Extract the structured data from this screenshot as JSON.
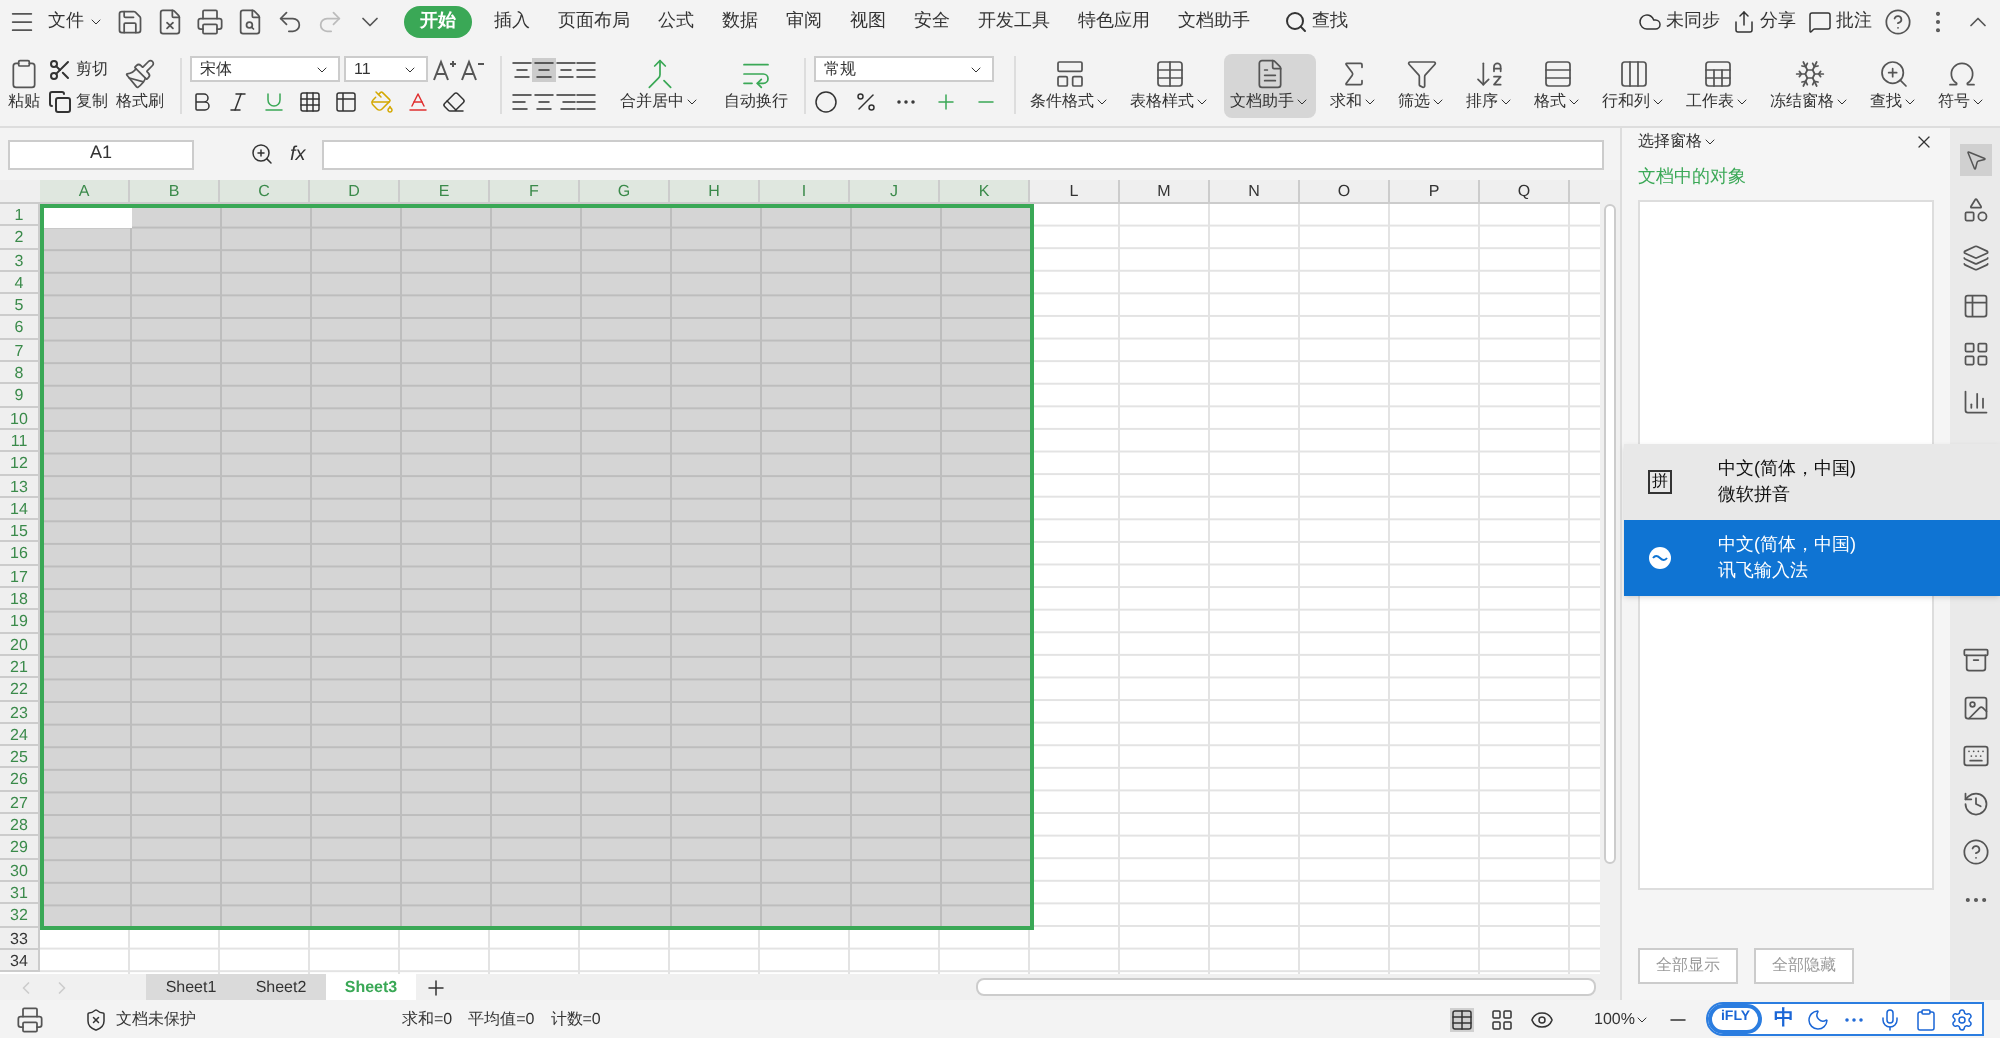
{
  "menu": {
    "file": "文件",
    "tabs": [
      {
        "label": "开始",
        "selected": true
      },
      {
        "label": "插入",
        "selected": false
      },
      {
        "label": "页面布局",
        "selected": false
      },
      {
        "label": "公式",
        "selected": false
      },
      {
        "label": "数据",
        "selected": false
      },
      {
        "label": "审阅",
        "selected": false
      },
      {
        "label": "视图",
        "selected": false
      },
      {
        "label": "安全",
        "selected": false
      },
      {
        "label": "开发工具",
        "selected": false
      },
      {
        "label": "特色应用",
        "selected": false
      },
      {
        "label": "文档助手",
        "selected": false
      }
    ],
    "search": "查找",
    "actions": [
      "未同步",
      "分享",
      "批注"
    ]
  },
  "ribbon": {
    "paste": "粘贴",
    "cut": "剪切",
    "copy": "复制",
    "painter": "格式刷",
    "font_name": "宋体",
    "font_size": "11",
    "merge": "合并居中",
    "wrap": "自动换行",
    "number_format": "常规",
    "tools": [
      {
        "label": "条件格式",
        "selected": false
      },
      {
        "label": "表格样式",
        "selected": false
      },
      {
        "label": "文档助手",
        "selected": true
      },
      {
        "label": "求和",
        "selected": false
      },
      {
        "label": "筛选",
        "selected": false
      },
      {
        "label": "排序",
        "selected": false
      },
      {
        "label": "格式",
        "selected": false
      },
      {
        "label": "行和列",
        "selected": false
      },
      {
        "label": "工作表",
        "selected": false
      },
      {
        "label": "冻结窗格",
        "selected": false
      },
      {
        "label": "查找",
        "selected": false
      },
      {
        "label": "符号",
        "selected": false
      }
    ]
  },
  "formula_bar": {
    "cell": "A1",
    "fx": "fx"
  },
  "grid": {
    "columns": [
      {
        "label": "A",
        "selected": true
      },
      {
        "label": "B",
        "selected": true
      },
      {
        "label": "C",
        "selected": true
      },
      {
        "label": "D",
        "selected": true
      },
      {
        "label": "E",
        "selected": true
      },
      {
        "label": "F",
        "selected": true
      },
      {
        "label": "G",
        "selected": true
      },
      {
        "label": "H",
        "selected": true
      },
      {
        "label": "I",
        "selected": true
      },
      {
        "label": "J",
        "selected": true
      },
      {
        "label": "K",
        "selected": true
      },
      {
        "label": "L",
        "selected": false
      },
      {
        "label": "M",
        "selected": false
      },
      {
        "label": "N",
        "selected": false
      },
      {
        "label": "O",
        "selected": false
      },
      {
        "label": "P",
        "selected": false
      },
      {
        "label": "Q",
        "selected": false
      }
    ],
    "rows": [
      {
        "label": "1",
        "selected": true
      },
      {
        "label": "2",
        "selected": true
      },
      {
        "label": "3",
        "selected": true
      },
      {
        "label": "4",
        "selected": true
      },
      {
        "label": "5",
        "selected": true
      },
      {
        "label": "6",
        "selected": true
      },
      {
        "label": "7",
        "selected": true
      },
      {
        "label": "8",
        "selected": true
      },
      {
        "label": "9",
        "selected": true
      },
      {
        "label": "10",
        "selected": true
      },
      {
        "label": "11",
        "selected": true
      },
      {
        "label": "12",
        "selected": true
      },
      {
        "label": "13",
        "selected": true
      },
      {
        "label": "14",
        "selected": true
      },
      {
        "label": "15",
        "selected": true
      },
      {
        "label": "16",
        "selected": true
      },
      {
        "label": "17",
        "selected": true
      },
      {
        "label": "18",
        "selected": true
      },
      {
        "label": "19",
        "selected": true
      },
      {
        "label": "20",
        "selected": true
      },
      {
        "label": "21",
        "selected": true
      },
      {
        "label": "22",
        "selected": true
      },
      {
        "label": "23",
        "selected": true
      },
      {
        "label": "24",
        "selected": true
      },
      {
        "label": "25",
        "selected": true
      },
      {
        "label": "26",
        "selected": true
      },
      {
        "label": "27",
        "selected": true
      },
      {
        "label": "28",
        "selected": true
      },
      {
        "label": "29",
        "selected": true
      },
      {
        "label": "30",
        "selected": true
      },
      {
        "label": "31",
        "selected": true
      },
      {
        "label": "32",
        "selected": true
      },
      {
        "label": "33",
        "selected": false
      },
      {
        "label": "34",
        "selected": false
      }
    ]
  },
  "sheets": [
    {
      "label": "Sheet1",
      "selected": false
    },
    {
      "label": "Sheet2",
      "selected": false
    },
    {
      "label": "Sheet3",
      "selected": true
    }
  ],
  "selection_pane": {
    "title": "选择窗格",
    "subtitle": "文档中的对象",
    "buttons": [
      "全部显示",
      "全部隐藏"
    ]
  },
  "ime_menu": [
    {
      "kind": "pinyin",
      "icon_text": "拼",
      "line1": "中文(简体，中国)",
      "line2": "微软拼音",
      "selected": false
    },
    {
      "kind": "ifly",
      "line1": "中文(简体，中国)",
      "line2": "讯飞输入法",
      "selected": true
    }
  ],
  "status_bar": {
    "protection": "文档未保护",
    "sum": "求和=0",
    "average": "平均值=0",
    "count": "计数=0",
    "zoom": "100%"
  },
  "ime_bar": {
    "logo": "iFLY",
    "mode": "中"
  }
}
